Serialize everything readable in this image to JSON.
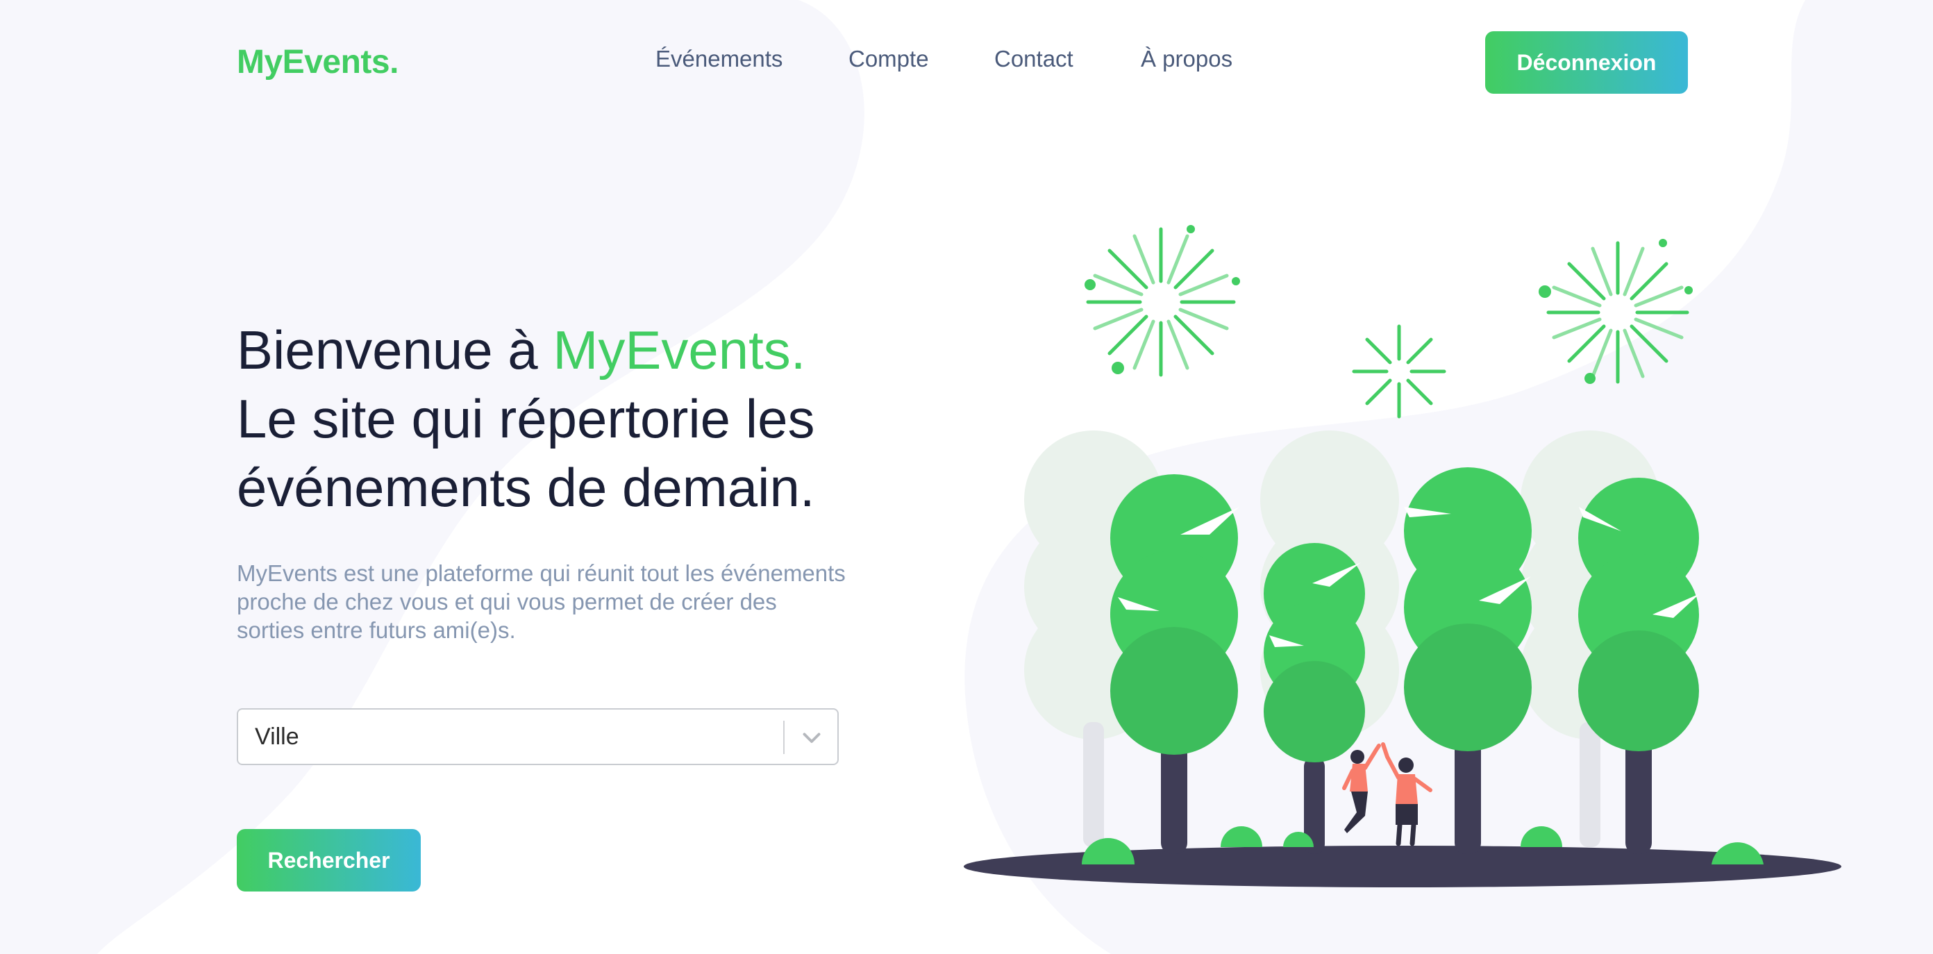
{
  "header": {
    "logo": "MyEvents.",
    "nav": [
      {
        "label": "Événements"
      },
      {
        "label": "Compte"
      },
      {
        "label": "Contact"
      },
      {
        "label": "À propos"
      }
    ],
    "logout_label": "Déconnexion"
  },
  "hero": {
    "title_part1": "Bienvenue à ",
    "title_accent": "MyEvents.",
    "title_line2": "Le site qui répertorie les",
    "title_line3": "événements de demain.",
    "description": "MyEvents est une plateforme qui réunit tout les événements proche de chez vous et qui vous permet de créer des sorties entre futurs ami(e)s.",
    "city_select": {
      "value": "Ville"
    },
    "search_label": "Rechercher"
  },
  "icons": {
    "chevron": "chevron-down-icon",
    "illustration": "celebration-illustration"
  },
  "colors": {
    "brand_green": "#42cd62",
    "brand_blue": "#3ab8d6",
    "text_dark": "#1a1f36",
    "nav_text": "#4a5a7a",
    "muted_text": "#8596b0",
    "ground": "#3f3d56"
  }
}
